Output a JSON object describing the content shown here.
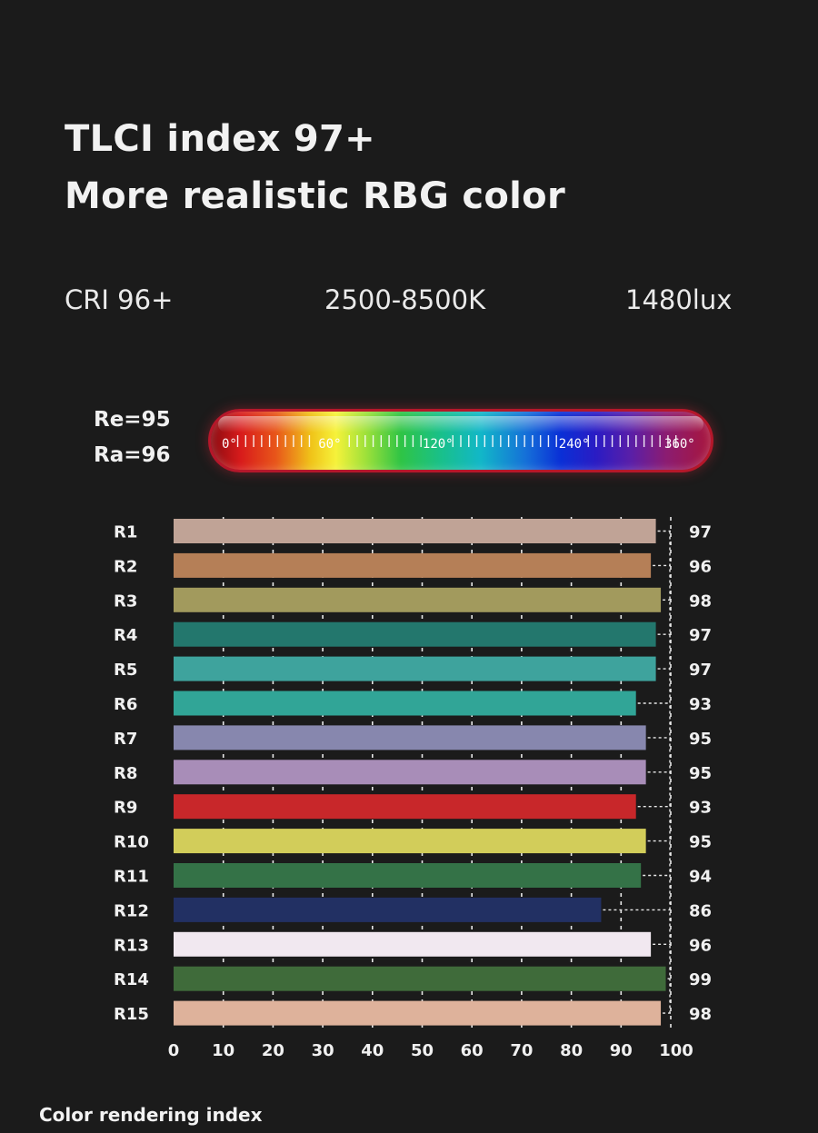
{
  "header": {
    "title_line1": "TLCI index 97+",
    "title_line2": "More realistic RBG color"
  },
  "specs": {
    "cri": "CRI 96+",
    "cct": "2500-8500K",
    "lux": "1480lux"
  },
  "indices": {
    "re": "Re=95",
    "ra": "Ra=96"
  },
  "hue_scale": {
    "labels": [
      "0°",
      "60°",
      "120°",
      "240°",
      "360°"
    ]
  },
  "chart_data": {
    "type": "bar",
    "orientation": "horizontal",
    "categories": [
      "R1",
      "R2",
      "R3",
      "R4",
      "R5",
      "R6",
      "R7",
      "R8",
      "R9",
      "R10",
      "R11",
      "R12",
      "R13",
      "R14",
      "R15"
    ],
    "values": [
      97,
      96,
      98,
      97,
      97,
      93,
      95,
      95,
      93,
      95,
      94,
      86,
      96,
      99,
      98
    ],
    "bar_colors": [
      "#c0a396",
      "#b57f57",
      "#a29a5d",
      "#23776d",
      "#3ea39d",
      "#31a597",
      "#8787ae",
      "#a88db8",
      "#c8272a",
      "#d2cd5a",
      "#347247",
      "#223063",
      "#f1e8f0",
      "#3f6b3a",
      "#deb29b"
    ],
    "xlim": [
      0,
      100
    ],
    "x_ticks": [
      0,
      10,
      20,
      30,
      40,
      50,
      60,
      70,
      80,
      90,
      100
    ],
    "grid": true,
    "xlabel": "",
    "ylabel": ""
  },
  "footer": {
    "caption": "Color rendering index"
  }
}
